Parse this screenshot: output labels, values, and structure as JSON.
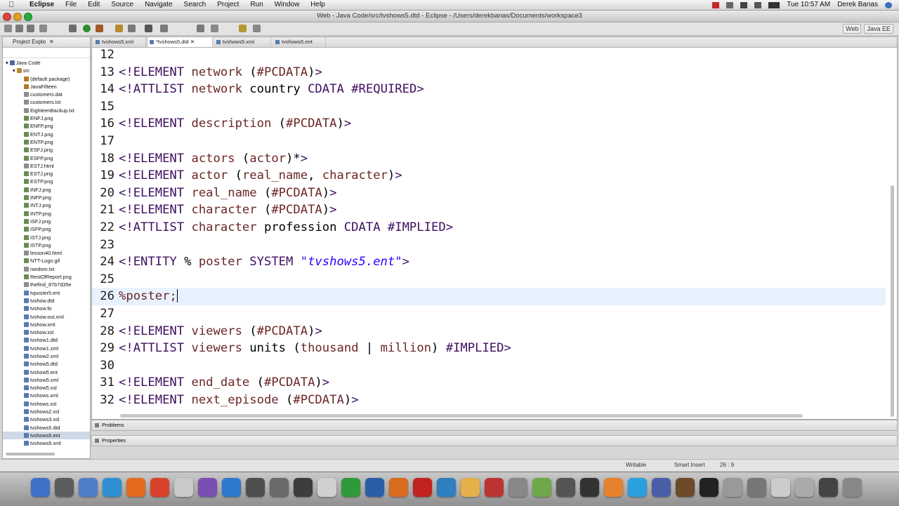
{
  "menubar": {
    "app_name": "Eclipse",
    "menus": [
      "File",
      "Edit",
      "Source",
      "Navigate",
      "Search",
      "Project",
      "Run",
      "Window",
      "Help"
    ],
    "clock": "Tue 10:57 AM",
    "user": "Derek Banas"
  },
  "window": {
    "title": "Web - Java Code/src/tvshows5.dtd - Eclipse - /Users/derekbanas/Documents/workspace3"
  },
  "perspectives": [
    "Web",
    "Java EE"
  ],
  "explorer": {
    "title": "Project Explo",
    "project": "Java Code",
    "folder": "src",
    "items": [
      {
        "label": "(default package)",
        "color": "#b07a2d"
      },
      {
        "label": "JavaFifteen",
        "color": "#b07a2d"
      },
      {
        "label": "customers.dat",
        "color": "#8d8d8d"
      },
      {
        "label": "customers.txt",
        "color": "#8d8d8d"
      },
      {
        "label": "EighteenBackup.txt",
        "color": "#8d8d8d"
      },
      {
        "label": "ENFJ.png",
        "color": "#6a8a57"
      },
      {
        "label": "ENFP.png",
        "color": "#6a8a57"
      },
      {
        "label": "ENTJ.png",
        "color": "#6a8a57"
      },
      {
        "label": "ENTP.png",
        "color": "#6a8a57"
      },
      {
        "label": "ESFJ.png",
        "color": "#6a8a57"
      },
      {
        "label": "ESFP.png",
        "color": "#6a8a57"
      },
      {
        "label": "ESTJ.html",
        "color": "#8d8d8d"
      },
      {
        "label": "ESTJ.png",
        "color": "#6a8a57"
      },
      {
        "label": "ESTP.png",
        "color": "#6a8a57"
      },
      {
        "label": "INFJ.png",
        "color": "#6a8a57"
      },
      {
        "label": "INFP.png",
        "color": "#6a8a57"
      },
      {
        "label": "INTJ.png",
        "color": "#6a8a57"
      },
      {
        "label": "INTP.png",
        "color": "#6a8a57"
      },
      {
        "label": "ISFJ.png",
        "color": "#6a8a57"
      },
      {
        "label": "ISFP.png",
        "color": "#6a8a57"
      },
      {
        "label": "ISTJ.png",
        "color": "#6a8a57"
      },
      {
        "label": "ISTP.png",
        "color": "#6a8a57"
      },
      {
        "label": "lesson40.html",
        "color": "#8d8d8d"
      },
      {
        "label": "NTT-Logo.gif",
        "color": "#6a8a57"
      },
      {
        "label": "random.txt",
        "color": "#8d8d8d"
      },
      {
        "label": "RestOfReport.png",
        "color": "#6a8a57"
      },
      {
        "label": "thefind_87b7d35e",
        "color": "#8d8d8d"
      },
      {
        "label": "tvposter5.ent",
        "color": "#5a7bb0"
      },
      {
        "label": "tvshow.dtd",
        "color": "#5a7bb0"
      },
      {
        "label": "tvshow.fo",
        "color": "#5a7bb0"
      },
      {
        "label": "tvshow.out.xml",
        "color": "#5a7bb0"
      },
      {
        "label": "tvshow.xml",
        "color": "#5a7bb0"
      },
      {
        "label": "tvshow.xsl",
        "color": "#5a7bb0"
      },
      {
        "label": "tvshow1.dtd",
        "color": "#5a7bb0"
      },
      {
        "label": "tvshow1.xml",
        "color": "#5a7bb0"
      },
      {
        "label": "tvshow2.xml",
        "color": "#5a7bb0"
      },
      {
        "label": "tvshow5.dtd",
        "color": "#5a7bb0"
      },
      {
        "label": "tvshow5.ent",
        "color": "#5a7bb0"
      },
      {
        "label": "tvshow5.xml",
        "color": "#5a7bb0"
      },
      {
        "label": "tvshow5.xsl",
        "color": "#5a7bb0"
      },
      {
        "label": "tvshows.xml",
        "color": "#5a7bb0"
      },
      {
        "label": "tvshows.xsl",
        "color": "#5a7bb0"
      },
      {
        "label": "tvshows2.xsl",
        "color": "#5a7bb0"
      },
      {
        "label": "tvshows3.xsl",
        "color": "#5a7bb0"
      },
      {
        "label": "tvshows5.dtd",
        "color": "#5a7bb0"
      },
      {
        "label": "tvshows5.ent",
        "color": "#5a7bb0",
        "selected": true
      },
      {
        "label": "tvshows5.xml",
        "color": "#5a7bb0"
      }
    ]
  },
  "editor": {
    "tabs": [
      {
        "label": "tvshows5.xml",
        "active": false
      },
      {
        "label": "*tvshows5.dtd",
        "active": true
      },
      {
        "label": "tvshows5.xml",
        "active": false
      },
      {
        "label": "tvshows5.ent",
        "active": false
      }
    ],
    "current_line": 26,
    "lines": [
      {
        "no": "12",
        "tokens": []
      },
      {
        "no": "13",
        "tokens": [
          [
            "k",
            "<!ELEMENT "
          ],
          [
            "n",
            "network "
          ],
          [
            "p",
            "("
          ],
          [
            "n",
            "#PCDATA"
          ],
          [
            "p",
            ")"
          ],
          [
            "k",
            ">"
          ]
        ]
      },
      {
        "no": "14",
        "tokens": [
          [
            "k",
            "<!ATTLIST "
          ],
          [
            "n",
            "network "
          ],
          [
            "a",
            "country "
          ],
          [
            "k",
            "CDATA "
          ],
          [
            "k",
            "#REQUIRED"
          ],
          [
            "k",
            ">"
          ]
        ]
      },
      {
        "no": "15",
        "tokens": []
      },
      {
        "no": "16",
        "tokens": [
          [
            "k",
            "<!ELEMENT "
          ],
          [
            "n",
            "description "
          ],
          [
            "p",
            "("
          ],
          [
            "n",
            "#PCDATA"
          ],
          [
            "p",
            ")"
          ],
          [
            "k",
            ">"
          ]
        ]
      },
      {
        "no": "17",
        "tokens": []
      },
      {
        "no": "18",
        "tokens": [
          [
            "k",
            "<!ELEMENT "
          ],
          [
            "n",
            "actors "
          ],
          [
            "p",
            "("
          ],
          [
            "n",
            "actor"
          ],
          [
            "p",
            ")*"
          ],
          [
            "k",
            ">"
          ]
        ]
      },
      {
        "no": "19",
        "tokens": [
          [
            "k",
            "<!ELEMENT "
          ],
          [
            "n",
            "actor "
          ],
          [
            "p",
            "("
          ],
          [
            "n",
            "real_name"
          ],
          [
            "p",
            ", "
          ],
          [
            "n",
            "character"
          ],
          [
            "p",
            ")"
          ],
          [
            "k",
            ">"
          ]
        ]
      },
      {
        "no": "20",
        "tokens": [
          [
            "k",
            "<!ELEMENT "
          ],
          [
            "n",
            "real_name "
          ],
          [
            "p",
            "("
          ],
          [
            "n",
            "#PCDATA"
          ],
          [
            "p",
            ")"
          ],
          [
            "k",
            ">"
          ]
        ]
      },
      {
        "no": "21",
        "tokens": [
          [
            "k",
            "<!ELEMENT "
          ],
          [
            "n",
            "character "
          ],
          [
            "p",
            "("
          ],
          [
            "n",
            "#PCDATA"
          ],
          [
            "p",
            ")"
          ],
          [
            "k",
            ">"
          ]
        ]
      },
      {
        "no": "22",
        "tokens": [
          [
            "k",
            "<!ATTLIST "
          ],
          [
            "n",
            "character "
          ],
          [
            "a",
            "profession "
          ],
          [
            "k",
            "CDATA "
          ],
          [
            "k",
            "#IMPLIED"
          ],
          [
            "k",
            ">"
          ]
        ]
      },
      {
        "no": "23",
        "tokens": []
      },
      {
        "no": "24",
        "tokens": [
          [
            "k",
            "<!ENTITY "
          ],
          [
            "p",
            "% "
          ],
          [
            "n",
            "poster "
          ],
          [
            "k",
            "SYSTEM "
          ],
          [
            "s",
            "\"tvshows5.ent\""
          ],
          [
            "k",
            ">"
          ]
        ]
      },
      {
        "no": "25",
        "tokens": []
      },
      {
        "no": "26",
        "tokens": [
          [
            "n",
            "%poster;"
          ]
        ]
      },
      {
        "no": "27",
        "tokens": []
      },
      {
        "no": "28",
        "tokens": [
          [
            "k",
            "<!ELEMENT "
          ],
          [
            "n",
            "viewers "
          ],
          [
            "p",
            "("
          ],
          [
            "n",
            "#PCDATA"
          ],
          [
            "p",
            ")"
          ],
          [
            "k",
            ">"
          ]
        ]
      },
      {
        "no": "29",
        "tokens": [
          [
            "k",
            "<!ATTLIST "
          ],
          [
            "n",
            "viewers "
          ],
          [
            "a",
            "units "
          ],
          [
            "p",
            "("
          ],
          [
            "n",
            "thousand "
          ],
          [
            "p",
            "| "
          ],
          [
            "n",
            "million"
          ],
          [
            "p",
            ") "
          ],
          [
            "k",
            "#IMPLIED"
          ],
          [
            "k",
            ">"
          ]
        ]
      },
      {
        "no": "30",
        "tokens": []
      },
      {
        "no": "31",
        "tokens": [
          [
            "k",
            "<!ELEMENT "
          ],
          [
            "n",
            "end_date "
          ],
          [
            "p",
            "("
          ],
          [
            "n",
            "#PCDATA"
          ],
          [
            "p",
            ")"
          ],
          [
            "k",
            ">"
          ]
        ]
      },
      {
        "no": "32",
        "tokens": [
          [
            "k",
            "<!ELEMENT "
          ],
          [
            "n",
            "next_episode "
          ],
          [
            "p",
            "("
          ],
          [
            "n",
            "#PCDATA"
          ],
          [
            "p",
            ")"
          ],
          [
            "k",
            ">"
          ]
        ]
      }
    ]
  },
  "views": {
    "problems": "Problems",
    "properties": "Properties"
  },
  "statusbar": {
    "writable": "Writable",
    "insert_mode": "Smart Insert",
    "position": "26 : 9"
  },
  "dock": {
    "colors": [
      "#3f71c8",
      "#5d5d5d",
      "#4f7ec9",
      "#2f8fd0",
      "#e46a1e",
      "#d9422b",
      "#c9c9c9",
      "#7a4fb3",
      "#2f78cf",
      "#4f4f4f",
      "#6a6a6a",
      "#3d3d3d",
      "#d0d0d0",
      "#2e9a3a",
      "#2a5ea6",
      "#d96b1f",
      "#c22222",
      "#2d7fbf",
      "#e3b04a",
      "#b33",
      "#888",
      "#6fa84a",
      "#555",
      "#333",
      "#e6822b",
      "#2ba0df",
      "#4a5ea8",
      "#6b4b2b",
      "#222",
      "#999",
      "#777",
      "#ccc",
      "#aaa",
      "#444",
      "#888"
    ]
  }
}
